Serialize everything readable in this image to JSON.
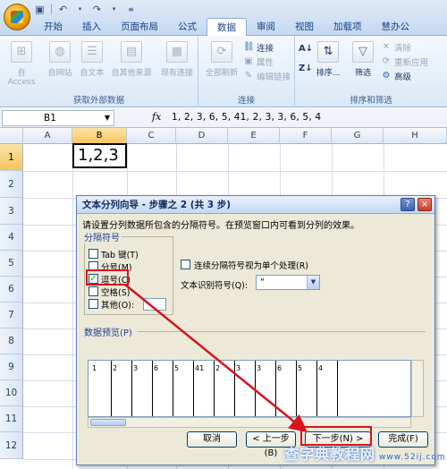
{
  "qat": {
    "save_icon": "save-icon",
    "undo_icon": "undo-icon",
    "redo_icon": "redo-icon"
  },
  "tabs": [
    "开始",
    "插入",
    "页面布局",
    "公式",
    "数据",
    "审阅",
    "视图",
    "加载项",
    "慧办公"
  ],
  "active_tab": "数据",
  "ribbon": {
    "external": {
      "label": "获取外部数据",
      "buttons": [
        "自 Access",
        "自网站",
        "自文本",
        "自其他来源",
        "现有连接"
      ]
    },
    "connections": {
      "label": "连接",
      "refresh_all": "全部刷新",
      "connections": "连接",
      "properties": "属性",
      "edit_links": "编辑链接"
    },
    "sort_filter": {
      "label": "排序和筛选",
      "sort": "排序...",
      "filter": "筛选",
      "clear": "清除",
      "reapply": "重新应用",
      "advanced": "高级"
    }
  },
  "formula_bar": {
    "name_box": "B1",
    "fx": "fx",
    "formula": "1, 2, 3, 6, 5, 41, 2, 3, 3, 6, 5, 4"
  },
  "grid": {
    "columns": [
      "A",
      "B",
      "C",
      "D",
      "E",
      "F",
      "G",
      "H"
    ],
    "rows": [
      "1",
      "2",
      "3",
      "4",
      "5",
      "6",
      "7",
      "8",
      "9",
      "10",
      "11",
      "12"
    ],
    "selected_cell_value": "1,2,3"
  },
  "dialog": {
    "title": "文本分列向导 - 步骤之 2 (共 3 步)",
    "help": "?",
    "close": "×",
    "description": "请设置分列数据所包含的分隔符号。在预览窗口内可看到分列的效果。",
    "delimiters_label": "分隔符号",
    "delimiters": [
      {
        "label": "Tab 键(T)",
        "checked": false
      },
      {
        "label": "分号(M)",
        "checked": false
      },
      {
        "label": "逗号(C)",
        "checked": true
      },
      {
        "label": "空格(S)",
        "checked": false
      },
      {
        "label": "其他(O):",
        "checked": false
      }
    ],
    "consecutive_label": "连续分隔符号视为单个处理(R)",
    "qualifier_label": "文本识别符号(Q):",
    "qualifier_value": "\"",
    "preview_label": "数据预览(P)",
    "preview_values": [
      "1",
      "2",
      "3",
      "6",
      "5",
      "41",
      "2",
      "3",
      "3",
      "6",
      "5",
      "4"
    ],
    "buttons": {
      "cancel": "取消",
      "back": "< 上一步(B)",
      "next": "下一步(N) >",
      "finish": "完成(F)"
    }
  },
  "watermark": {
    "text": "查字典教程网",
    "url": "www.52ij.com"
  },
  "colors": {
    "annotation_red": "#d8141c",
    "ribbon_blue": "#15428b"
  }
}
